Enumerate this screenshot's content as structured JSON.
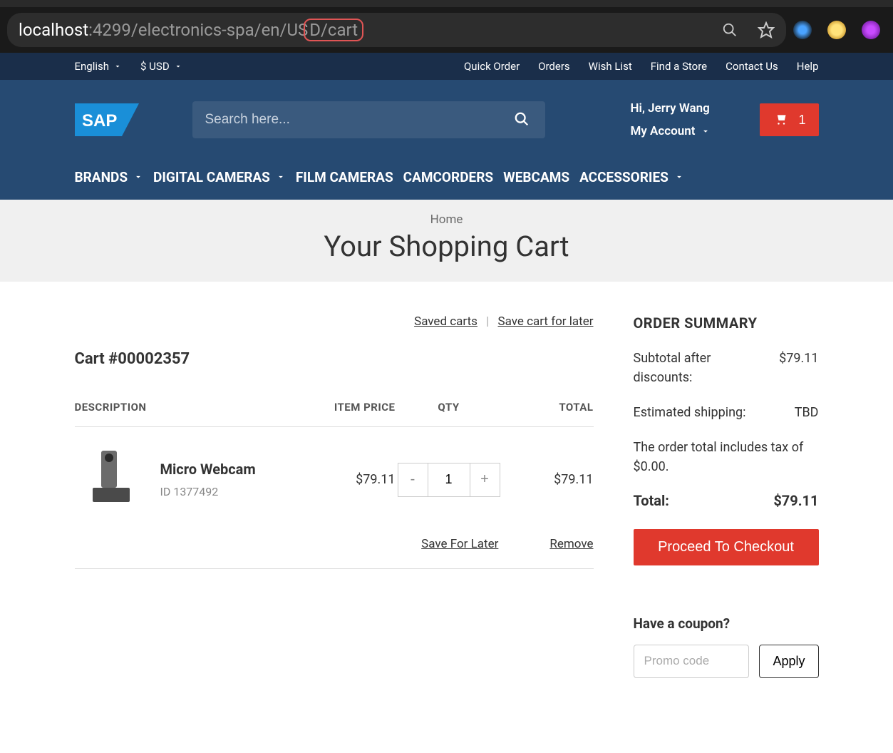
{
  "browser": {
    "url_host": "localhost",
    "url_path_pre": ":4299/electronics-spa/en/US",
    "url_path_highlight": "D/cart"
  },
  "utility": {
    "language": "English",
    "currency": "$ USD",
    "links": [
      "Quick Order",
      "Orders",
      "Wish List",
      "Find a Store",
      "Contact Us",
      "Help"
    ]
  },
  "header": {
    "search_placeholder": "Search here...",
    "greeting": "Hi, Jerry Wang",
    "my_account": "My Account",
    "cart_count": "1"
  },
  "nav": {
    "items": [
      {
        "label": "BRANDS",
        "dropdown": true
      },
      {
        "label": "DIGITAL CAMERAS",
        "dropdown": true
      },
      {
        "label": "FILM CAMERAS",
        "dropdown": false
      },
      {
        "label": "CAMCORDERS",
        "dropdown": false
      },
      {
        "label": "WEBCAMS",
        "dropdown": false
      },
      {
        "label": "ACCESSORIES",
        "dropdown": true
      }
    ]
  },
  "breadcrumb": "Home",
  "page_title": "Your Shopping Cart",
  "cart": {
    "saved_link": "Saved carts",
    "save_later_link": "Save cart for later",
    "cart_id_label": "Cart #00002357",
    "columns": {
      "desc": "DESCRIPTION",
      "price": "ITEM PRICE",
      "qty": "QTY",
      "total": "TOTAL"
    },
    "item": {
      "name": "Micro Webcam",
      "id": "ID 1377492",
      "price": "$79.11",
      "qty": "1",
      "total": "$79.11",
      "save_for_later": "Save For Later",
      "remove": "Remove"
    }
  },
  "summary": {
    "title": "ORDER SUMMARY",
    "subtotal_label": "Subtotal after discounts:",
    "subtotal_value": "$79.11",
    "shipping_label": "Estimated shipping:",
    "shipping_value": "TBD",
    "tax_note": "The order total includes tax of $0.00.",
    "total_label": "Total:",
    "total_value": "$79.11",
    "checkout": "Proceed To Checkout",
    "coupon_title": "Have a coupon?",
    "promo_placeholder": "Promo code",
    "apply": "Apply"
  }
}
